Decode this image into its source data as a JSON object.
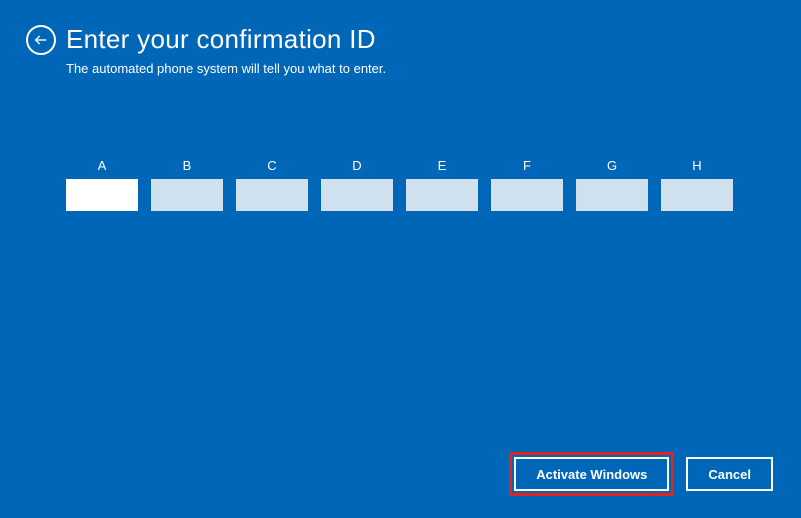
{
  "header": {
    "title": "Enter your confirmation ID",
    "subtitle": "The automated phone system will tell you what to enter."
  },
  "segments": {
    "labels": [
      "A",
      "B",
      "C",
      "D",
      "E",
      "F",
      "G",
      "H"
    ],
    "values": [
      "",
      "",
      "",
      "",
      "",
      "",
      "",
      ""
    ],
    "active_index": 0
  },
  "footer": {
    "activate_label": "Activate Windows",
    "cancel_label": "Cancel"
  }
}
